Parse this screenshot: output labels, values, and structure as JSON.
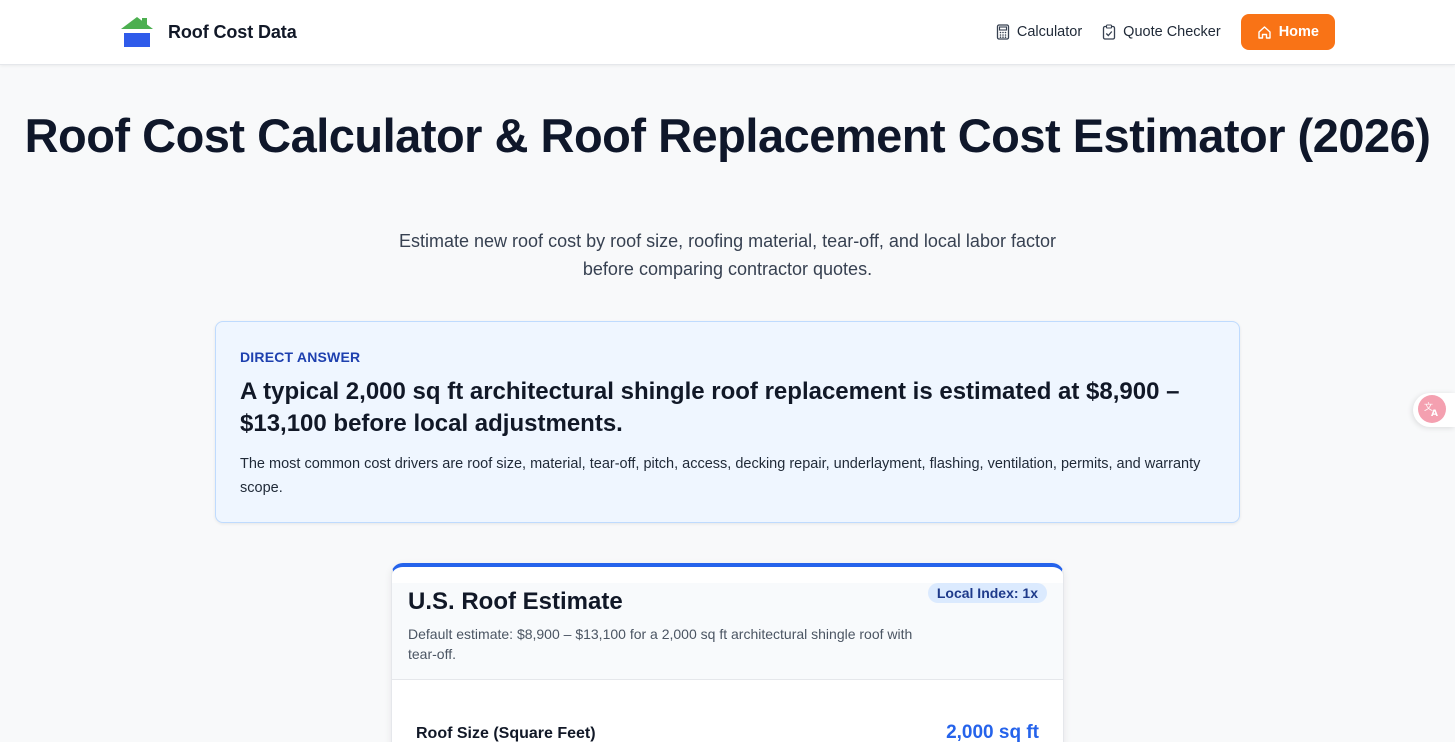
{
  "header": {
    "brand_name": "Roof Cost Data",
    "nav": [
      {
        "label": "Calculator",
        "icon": "calculator-icon"
      },
      {
        "label": "Quote Checker",
        "icon": "clipboard-check-icon"
      }
    ],
    "home_label": "Home",
    "home_icon": "home-icon"
  },
  "hero": {
    "title": "Roof Cost Calculator & Roof Replacement Cost Estimator (2026)",
    "subtitle": "Estimate new roof cost by roof size, roofing material, tear-off, and local labor factor before comparing contractor quotes."
  },
  "direct_answer": {
    "eyebrow": "DIRECT ANSWER",
    "headline": "A typical 2,000 sq ft architectural shingle roof replacement is estimated at $8,900 – $13,100 before local adjustments.",
    "body": "The most common cost drivers are roof size, material, tear-off, pitch, access, decking repair, underlayment, flashing, ventilation, permits, and warranty scope."
  },
  "estimate_card": {
    "title": "U.S. Roof Estimate",
    "description": "Default estimate: $8,900 – $13,100 for a 2,000 sq ft architectural shingle roof with tear-off.",
    "badge": "Local Index: 1x",
    "field_label": "Roof Size (Square Feet)",
    "field_value": "2,000 sq ft"
  },
  "floating_widget": {
    "icon": "translate-icon"
  },
  "colors": {
    "accent_orange": "#f97316",
    "accent_blue": "#2563eb",
    "answer_bg": "#eff6ff",
    "logo_green": "#4caf50",
    "logo_blue": "#2f5bea"
  }
}
